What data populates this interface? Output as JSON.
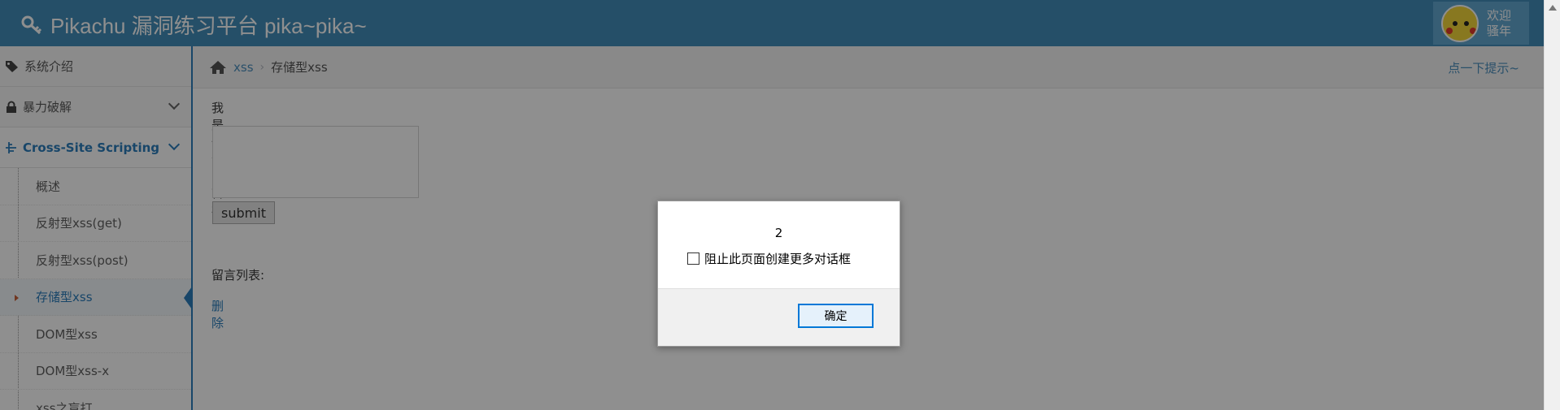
{
  "navbar": {
    "brand": "Pikachu 漏洞练习平台 pika~pika~",
    "welcome_line1": "欢迎",
    "welcome_line2": "骚年"
  },
  "sidebar": {
    "items": [
      {
        "label": "系统介绍",
        "icon": "tags-icon"
      },
      {
        "label": "暴力破解",
        "icon": "lock-icon"
      },
      {
        "label": "Cross-Site Scripting",
        "icon": "tree-icon"
      }
    ],
    "submenu": [
      "概述",
      "反射型xss(get)",
      "反射型xss(post)",
      "存储型xss",
      "DOM型xss",
      "DOM型xss-x",
      "xss之盲打"
    ]
  },
  "breadcrumb": {
    "parent": "xss",
    "current": "存储型xss",
    "hint": "点一下提示~"
  },
  "content": {
    "board_label": "我是一个留言板:",
    "submit_label": "submit",
    "list_label": "留言列表:",
    "delete_label": "删除"
  },
  "dialog": {
    "message": "2",
    "checkbox_label": "阻止此页面创建更多对话框",
    "ok_label": "确定"
  },
  "colors": {
    "header": "#438eb9",
    "accent": "#2b7dbc"
  }
}
